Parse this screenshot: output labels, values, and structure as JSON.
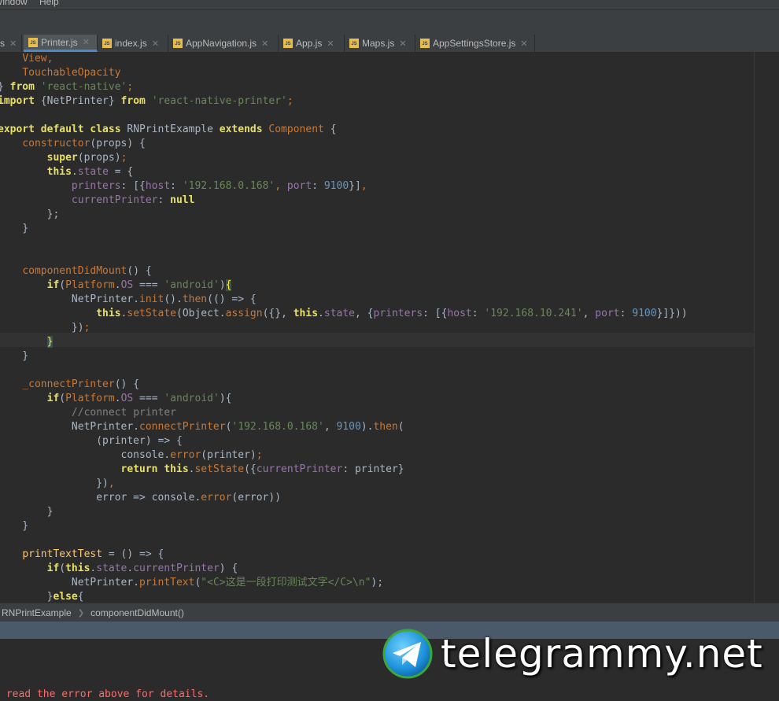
{
  "menu": {
    "items": [
      "Window",
      "Help"
    ]
  },
  "tabs": [
    {
      "label": "s",
      "active": false
    },
    {
      "label": "Printer.js",
      "active": true
    },
    {
      "label": "index.js",
      "active": false
    },
    {
      "label": "AppNavigation.js",
      "active": false
    },
    {
      "label": "App.js",
      "active": false
    },
    {
      "label": "Maps.js",
      "active": false
    },
    {
      "label": "AppSettingsStore.js",
      "active": false
    }
  ],
  "breadcrumb": {
    "class_name": "RNPrintExample",
    "method_name": "componentDidMount()"
  },
  "console": {
    "error_text": " read the error above for details."
  },
  "watermark": {
    "text": "telegrammy.net"
  },
  "icons": {
    "file_icon": "js-file-icon",
    "close": "close-icon",
    "separator": "chevron-right-icon",
    "logo": "telegram-logo-icon"
  },
  "colors": {
    "keyword": "#cc7832",
    "string": "#6a8759",
    "number": "#6897bb",
    "property": "#9876aa",
    "function": "#ffc66d",
    "comment": "#808080",
    "error": "#ff6b68",
    "active_tab_accent": "#4a88c7"
  },
  "code": {
    "lines": [
      [
        {
          "t": "    ",
          "c": "pl"
        },
        {
          "t": "View,",
          "c": "kw"
        }
      ],
      [
        {
          "t": "    ",
          "c": "pl"
        },
        {
          "t": "TouchableOpacity",
          "c": "kw"
        }
      ],
      [
        {
          "t": "} ",
          "c": "pl"
        },
        {
          "t": "from",
          "c": "kwy"
        },
        {
          "t": " ",
          "c": "pl"
        },
        {
          "t": "'react-native'",
          "c": "str"
        },
        {
          "t": ";",
          "c": "kw"
        }
      ],
      [
        {
          "t": "import",
          "c": "kwy"
        },
        {
          "t": " {NetPrinter} ",
          "c": "pl"
        },
        {
          "t": "from",
          "c": "kwy"
        },
        {
          "t": " ",
          "c": "pl"
        },
        {
          "t": "'react-native-printer'",
          "c": "str"
        },
        {
          "t": ";",
          "c": "kw"
        }
      ],
      [],
      [
        {
          "t": "export default class",
          "c": "kwy"
        },
        {
          "t": " RNPrintExample ",
          "c": "pl"
        },
        {
          "t": "extends",
          "c": "kwy"
        },
        {
          "t": " ",
          "c": "pl"
        },
        {
          "t": "Component",
          "c": "kw"
        },
        {
          "t": " {",
          "c": "pl"
        }
      ],
      [
        {
          "t": "    ",
          "c": "pl"
        },
        {
          "t": "constructor",
          "c": "kw"
        },
        {
          "t": "(props) {",
          "c": "pl"
        }
      ],
      [
        {
          "t": "        ",
          "c": "pl"
        },
        {
          "t": "super",
          "c": "kwy"
        },
        {
          "t": "(props)",
          "c": "pl"
        },
        {
          "t": ";",
          "c": "kw"
        }
      ],
      [
        {
          "t": "        ",
          "c": "pl"
        },
        {
          "t": "this",
          "c": "kwy"
        },
        {
          "t": ".",
          "c": "pl"
        },
        {
          "t": "state",
          "c": "prop"
        },
        {
          "t": " = {",
          "c": "pl"
        }
      ],
      [
        {
          "t": "            ",
          "c": "pl"
        },
        {
          "t": "printers",
          "c": "prop"
        },
        {
          "t": ": [{",
          "c": "pl"
        },
        {
          "t": "host",
          "c": "prop"
        },
        {
          "t": ": ",
          "c": "pl"
        },
        {
          "t": "'192.168.0.168'",
          "c": "str"
        },
        {
          "t": ", ",
          "c": "kw"
        },
        {
          "t": "port",
          "c": "prop"
        },
        {
          "t": ": ",
          "c": "pl"
        },
        {
          "t": "9100",
          "c": "num"
        },
        {
          "t": "}]",
          "c": "pl"
        },
        {
          "t": ",",
          "c": "kw"
        }
      ],
      [
        {
          "t": "            ",
          "c": "pl"
        },
        {
          "t": "currentPrinter",
          "c": "prop"
        },
        {
          "t": ": ",
          "c": "pl"
        },
        {
          "t": "null",
          "c": "kwy"
        }
      ],
      [
        {
          "t": "        };",
          "c": "pl"
        }
      ],
      [
        {
          "t": "    }",
          "c": "pl"
        }
      ],
      [],
      [],
      [
        {
          "t": "    ",
          "c": "pl"
        },
        {
          "t": "componentDidMount",
          "c": "kw"
        },
        {
          "t": "() {",
          "c": "pl"
        }
      ],
      [
        {
          "t": "        ",
          "c": "pl"
        },
        {
          "t": "if",
          "c": "kwy"
        },
        {
          "t": "(",
          "c": "pl"
        },
        {
          "t": "Platform",
          "c": "kw"
        },
        {
          "t": ".",
          "c": "pl"
        },
        {
          "t": "OS",
          "c": "prop"
        },
        {
          "t": " === ",
          "c": "pl"
        },
        {
          "t": "'android'",
          "c": "str"
        },
        {
          "t": ")",
          "c": "pl"
        },
        {
          "t": "{",
          "c": "br"
        }
      ],
      [
        {
          "t": "            NetPrinter.",
          "c": "pl"
        },
        {
          "t": "init",
          "c": "kw"
        },
        {
          "t": "().",
          "c": "pl"
        },
        {
          "t": "then",
          "c": "kw"
        },
        {
          "t": "(() => {",
          "c": "pl"
        }
      ],
      [
        {
          "t": "                ",
          "c": "pl"
        },
        {
          "t": "this",
          "c": "kwy"
        },
        {
          "t": ".",
          "c": "pl"
        },
        {
          "t": "setState",
          "c": "kw"
        },
        {
          "t": "(Object.",
          "c": "pl"
        },
        {
          "t": "assign",
          "c": "kw"
        },
        {
          "t": "({}, ",
          "c": "pl"
        },
        {
          "t": "this",
          "c": "kwy"
        },
        {
          "t": ".",
          "c": "pl"
        },
        {
          "t": "state",
          "c": "prop"
        },
        {
          "t": ", {",
          "c": "pl"
        },
        {
          "t": "printers",
          "c": "prop"
        },
        {
          "t": ": [{",
          "c": "pl"
        },
        {
          "t": "host",
          "c": "prop"
        },
        {
          "t": ": ",
          "c": "pl"
        },
        {
          "t": "'192.168.10.241'",
          "c": "str"
        },
        {
          "t": ", ",
          "c": "pl"
        },
        {
          "t": "port",
          "c": "prop"
        },
        {
          "t": ": ",
          "c": "pl"
        },
        {
          "t": "9100",
          "c": "num"
        },
        {
          "t": "}]}))",
          "c": "pl"
        }
      ],
      [
        {
          "t": "            })",
          "c": "pl"
        },
        {
          "t": ";",
          "c": "kw"
        }
      ],
      [
        {
          "t": "        ",
          "c": "pl"
        },
        {
          "t": "}",
          "c": "br"
        }
      ],
      [
        {
          "t": "    }",
          "c": "pl"
        }
      ],
      [],
      [
        {
          "t": "    ",
          "c": "pl"
        },
        {
          "t": "_connectPrinter",
          "c": "kw"
        },
        {
          "t": "() {",
          "c": "pl"
        }
      ],
      [
        {
          "t": "        ",
          "c": "pl"
        },
        {
          "t": "if",
          "c": "kwy"
        },
        {
          "t": "(",
          "c": "pl"
        },
        {
          "t": "Platform",
          "c": "kw"
        },
        {
          "t": ".",
          "c": "pl"
        },
        {
          "t": "OS",
          "c": "prop"
        },
        {
          "t": " === ",
          "c": "pl"
        },
        {
          "t": "'android'",
          "c": "str"
        },
        {
          "t": "){",
          "c": "pl"
        }
      ],
      [
        {
          "t": "            ",
          "c": "pl"
        },
        {
          "t": "//connect printer",
          "c": "cm"
        }
      ],
      [
        {
          "t": "            NetPrinter.",
          "c": "pl"
        },
        {
          "t": "connectPrinter",
          "c": "kw"
        },
        {
          "t": "(",
          "c": "pl"
        },
        {
          "t": "'192.168.0.168'",
          "c": "str"
        },
        {
          "t": ", ",
          "c": "pl"
        },
        {
          "t": "9100",
          "c": "num"
        },
        {
          "t": ").",
          "c": "pl"
        },
        {
          "t": "then",
          "c": "kw"
        },
        {
          "t": "(",
          "c": "pl"
        }
      ],
      [
        {
          "t": "                (printer) => {",
          "c": "pl"
        }
      ],
      [
        {
          "t": "                    console.",
          "c": "pl"
        },
        {
          "t": "error",
          "c": "kw"
        },
        {
          "t": "(printer)",
          "c": "pl"
        },
        {
          "t": ";",
          "c": "kw"
        }
      ],
      [
        {
          "t": "                    ",
          "c": "pl"
        },
        {
          "t": "return this",
          "c": "kwy"
        },
        {
          "t": ".",
          "c": "pl"
        },
        {
          "t": "setState",
          "c": "kw"
        },
        {
          "t": "({",
          "c": "pl"
        },
        {
          "t": "currentPrinter",
          "c": "prop"
        },
        {
          "t": ": printer}",
          "c": "pl"
        }
      ],
      [
        {
          "t": "                })",
          "c": "pl"
        },
        {
          "t": ",",
          "c": "kw"
        }
      ],
      [
        {
          "t": "                error => console.",
          "c": "pl"
        },
        {
          "t": "error",
          "c": "kw"
        },
        {
          "t": "(error))",
          "c": "pl"
        }
      ],
      [
        {
          "t": "        }",
          "c": "pl"
        }
      ],
      [
        {
          "t": "    }",
          "c": "pl"
        }
      ],
      [],
      [
        {
          "t": "    ",
          "c": "pl"
        },
        {
          "t": "printTextTest",
          "c": "fn"
        },
        {
          "t": " = () => {",
          "c": "pl"
        }
      ],
      [
        {
          "t": "        ",
          "c": "pl"
        },
        {
          "t": "if",
          "c": "kwy"
        },
        {
          "t": "(",
          "c": "pl"
        },
        {
          "t": "this",
          "c": "kwy"
        },
        {
          "t": ".",
          "c": "pl"
        },
        {
          "t": "state",
          "c": "prop"
        },
        {
          "t": ".",
          "c": "pl"
        },
        {
          "t": "currentPrinter",
          "c": "prop"
        },
        {
          "t": ") {",
          "c": "pl"
        }
      ],
      [
        {
          "t": "            NetPrinter.",
          "c": "pl"
        },
        {
          "t": "printText",
          "c": "kw"
        },
        {
          "t": "(",
          "c": "pl"
        },
        {
          "t": "\"<C>这是一段打印测试文字</C>\\n\"",
          "c": "str"
        },
        {
          "t": ");",
          "c": "pl"
        }
      ],
      [
        {
          "t": "        }",
          "c": "pl"
        },
        {
          "t": "else",
          "c": "kwy"
        },
        {
          "t": "{",
          "c": "pl"
        }
      ]
    ]
  }
}
